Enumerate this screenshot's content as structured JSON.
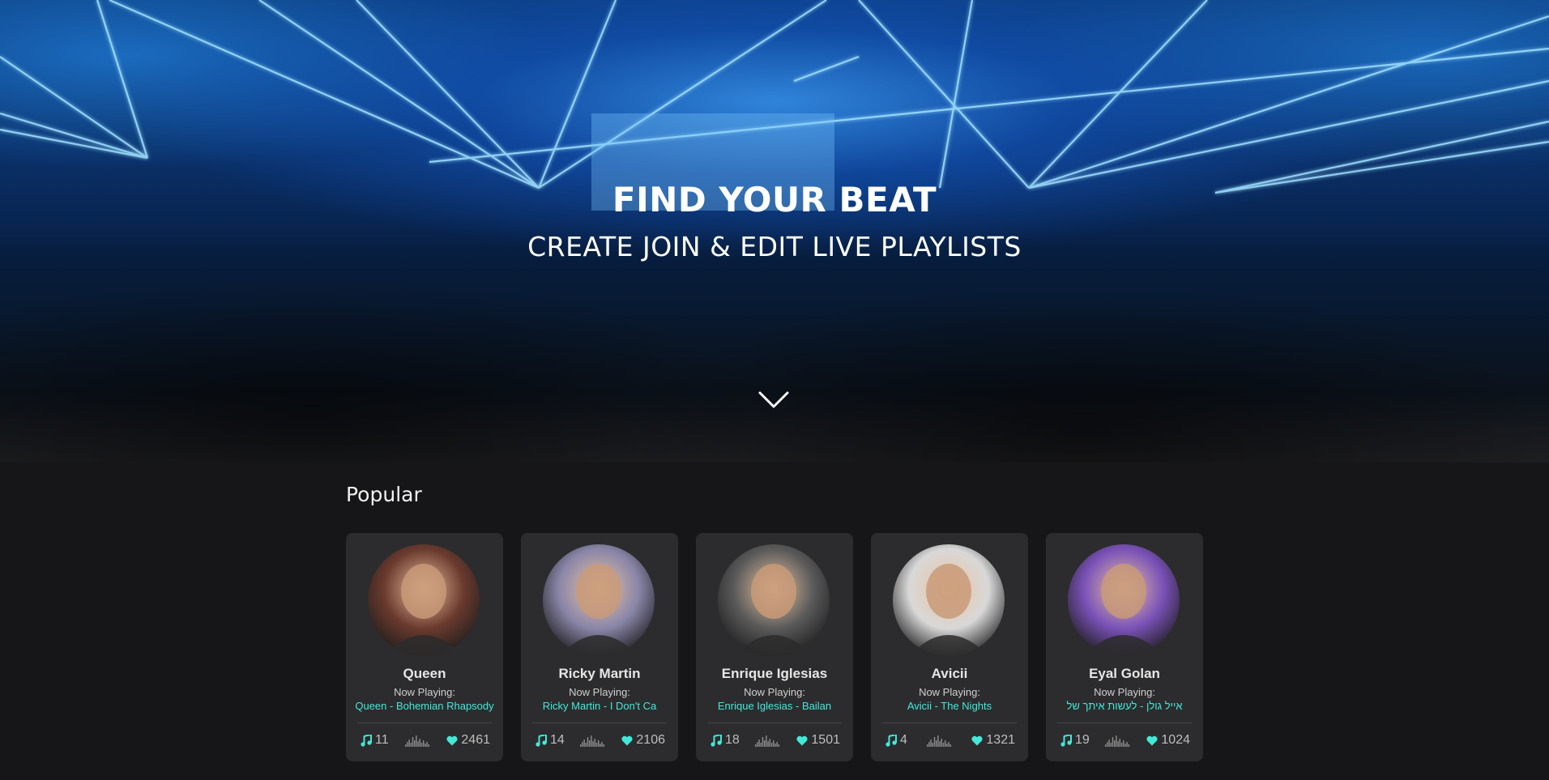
{
  "hero": {
    "title": "FIND YOUR BEAT",
    "subtitle": "CREATE JOIN & EDIT LIVE PLAYLISTS",
    "scroll_icon": "chevron-down-icon"
  },
  "popular": {
    "heading": "Popular",
    "now_playing_label": "Now Playing:",
    "cards": [
      {
        "name": "Queen",
        "track": "Queen - Bohemian Rhapsody",
        "songs": "11",
        "likes": "2461",
        "avatar_color": "#6b3a2e"
      },
      {
        "name": "Ricky Martin",
        "track": "Ricky Martin - I Don't Ca",
        "songs": "14",
        "likes": "2106",
        "avatar_color": "#8a86a8"
      },
      {
        "name": "Enrique Iglesias",
        "track": "Enrique Iglesias - Bailan",
        "songs": "18",
        "likes": "1501",
        "avatar_color": "#5a5a5a"
      },
      {
        "name": "Avicii",
        "track": "Avicii - The Nights",
        "songs": "4",
        "likes": "1321",
        "avatar_color": "#d8d8d8"
      },
      {
        "name": "Eyal Golan",
        "track": "אייל גולן - לעשות איתך של",
        "songs": "19",
        "likes": "1024",
        "avatar_color": "#7a52b8"
      }
    ]
  },
  "colors": {
    "accent": "#43e8d8",
    "card_bg": "#2c2c2e",
    "page_bg": "#161618"
  },
  "icons": {
    "songs": "music-note-icon",
    "activity": "sound-wave-icon",
    "likes": "heart-icon"
  }
}
